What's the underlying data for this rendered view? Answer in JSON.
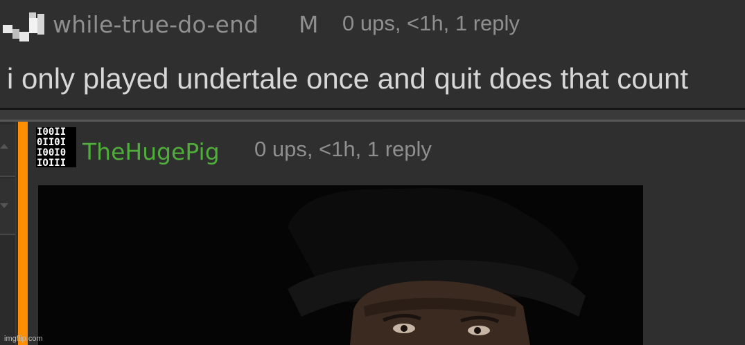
{
  "comment": {
    "username": "while-true-do-end",
    "flag": "M",
    "meta": "0 ups, <1h, 1 reply",
    "text": "i only played undertale once and quit does that count",
    "avatar_icon": "pixel-blocks-icon"
  },
  "reply": {
    "username": "TheHugePig",
    "meta": "0 ups, <1h, 1 reply",
    "avatar_lines": [
      "I00II",
      "0II0I",
      "I00I0",
      "IOIII"
    ],
    "avatar_icon": "binary-avatar-icon",
    "accent_color": "#ff8f00",
    "username_color": "#4fae3a",
    "image_icon": "meme-image-man-hat"
  },
  "watermark": "imgflip.com"
}
